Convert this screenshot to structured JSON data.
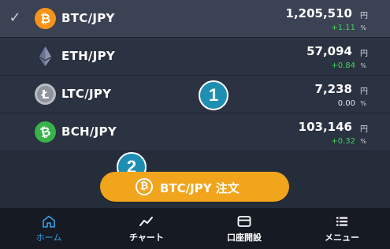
{
  "pairs": [
    {
      "symbol": "BTC/JPY",
      "price": "1,205,510",
      "currency": "円",
      "change": "+1.11",
      "pct": "%",
      "selected": true,
      "coin": "bitcoin-icon",
      "coin_color": "#f7931a"
    },
    {
      "symbol": "ETH/JPY",
      "price": "57,094",
      "currency": "円",
      "change": "+0.84",
      "pct": "%",
      "selected": false,
      "coin": "ethereum-icon",
      "coin_color": "#5f6a8a"
    },
    {
      "symbol": "LTC/JPY",
      "price": "7,238",
      "currency": "円",
      "change": "0.00",
      "pct": "%",
      "selected": false,
      "coin": "litecoin-icon",
      "coin_color": "#b9bcc2"
    },
    {
      "symbol": "BCH/JPY",
      "price": "103,146",
      "currency": "円",
      "change": "+0.32",
      "pct": "%",
      "selected": false,
      "coin": "bitcoin-cash-icon",
      "coin_color": "#37b34a"
    }
  ],
  "callouts": {
    "one": "1",
    "two": "2"
  },
  "order_button": {
    "label": "BTC/JPY 注文",
    "coin_glyph": "₿"
  },
  "tabs": [
    {
      "label": "ホーム",
      "icon": "home-icon",
      "active": true
    },
    {
      "label": "チャート",
      "icon": "chart-icon",
      "active": false
    },
    {
      "label": "口座開設",
      "icon": "account-card-icon",
      "active": false
    },
    {
      "label": "メニュー",
      "icon": "menu-list-icon",
      "active": false
    }
  ],
  "colors": {
    "accent": "#f0a51d",
    "positive": "#46d160",
    "active_tab": "#3aa0e8",
    "badge": "#1e8fb3"
  }
}
